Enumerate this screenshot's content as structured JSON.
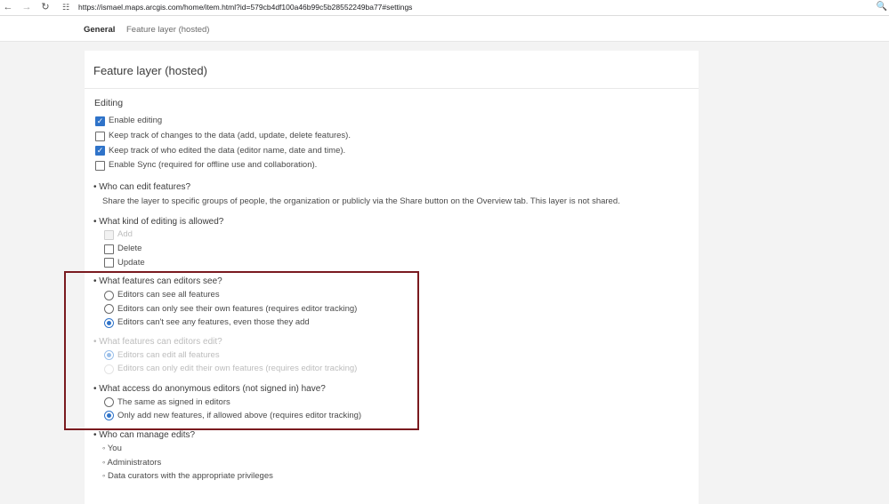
{
  "browser": {
    "url": "https://ismael.maps.arcgis.com/home/item.html?id=579cb4df100a46b99c5b28552249ba77#settings"
  },
  "tabs": [
    {
      "label": "General",
      "active": true
    },
    {
      "label": "Feature layer (hosted)",
      "active": false
    }
  ],
  "card": {
    "title": "Feature layer (hosted)",
    "editing_heading": "Editing",
    "editing_options": [
      {
        "label": "Enable editing",
        "checked": true
      },
      {
        "label": "Keep track of changes to the data (add, update, delete features).",
        "checked": false
      },
      {
        "label": "Keep track of who edited the data (editor name, date and time).",
        "checked": true
      },
      {
        "label": "Enable Sync (required for offline use and collaboration).",
        "checked": false
      }
    ],
    "who_can_edit": {
      "question": "• Who can edit features?",
      "answer": "Share the layer to specific groups of people, the organization or publicly via the Share button on the Overview tab. This layer is not shared."
    },
    "kind_of_editing": {
      "question": "• What kind of editing is allowed?",
      "options": [
        {
          "label": "Add",
          "checked": true,
          "disabled": true
        },
        {
          "label": "Delete",
          "checked": false,
          "disabled": false
        },
        {
          "label": "Update",
          "checked": false,
          "disabled": false
        }
      ]
    },
    "features_see": {
      "question": "• What features can editors see?",
      "options": [
        {
          "label": "Editors can see all features",
          "selected": false
        },
        {
          "label": "Editors can only see their own features (requires editor tracking)",
          "selected": false
        },
        {
          "label": "Editors can't see any features, even those they add",
          "selected": true
        }
      ]
    },
    "features_edit": {
      "question": "• What features can editors edit?",
      "options": [
        {
          "label": "Editors can edit all features",
          "selected": true
        },
        {
          "label": "Editors can only edit their own features (requires editor tracking)",
          "selected": false
        }
      ]
    },
    "anonymous_access": {
      "question": "• What access do anonymous editors (not signed in) have?",
      "options": [
        {
          "label": "The same as signed in editors",
          "selected": false
        },
        {
          "label": "Only add new features, if allowed above (requires editor tracking)",
          "selected": true
        }
      ]
    },
    "manage_edits": {
      "question": "• Who can manage edits?",
      "items": [
        "◦ You",
        "◦ Administrators",
        "◦ Data curators with the appropriate privileges"
      ]
    }
  },
  "colors": {
    "accent": "#2f73c9",
    "highlight_border": "#7a1a1f"
  },
  "icons": [
    "back-arrow-icon",
    "forward-arrow-icon",
    "reload-icon",
    "site-settings-icon",
    "zoom-icon"
  ]
}
